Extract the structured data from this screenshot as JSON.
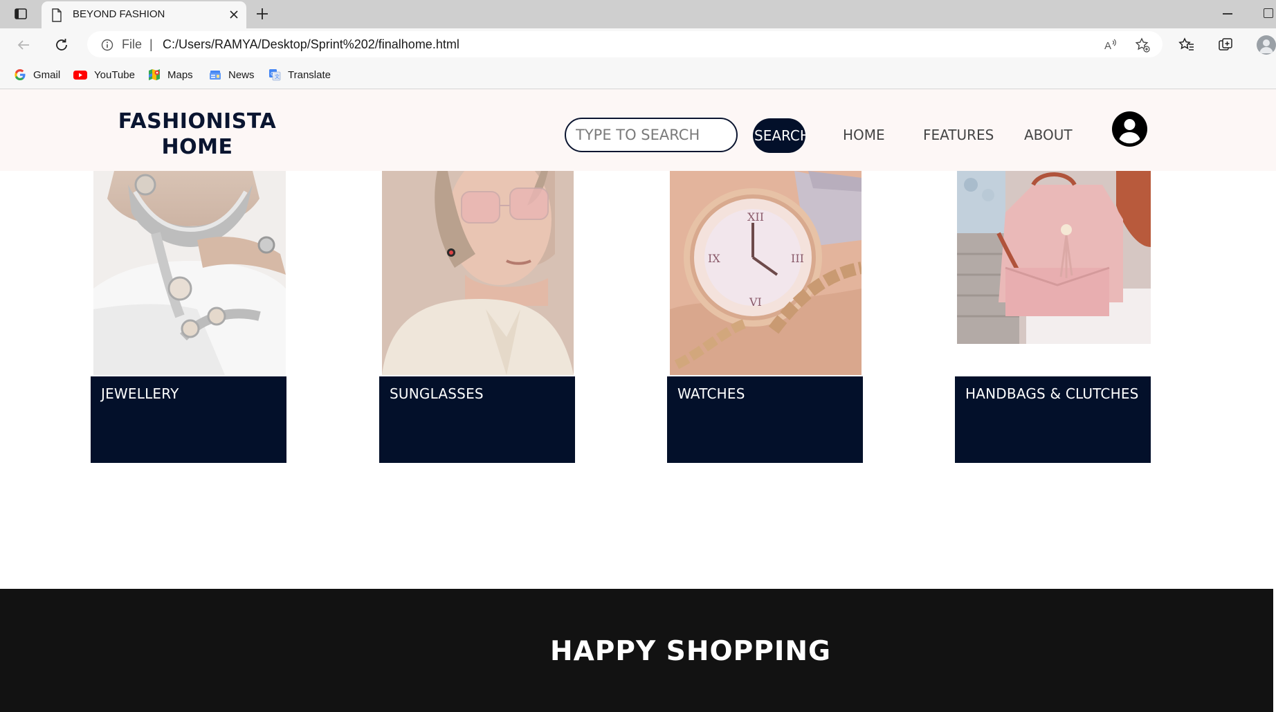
{
  "browser": {
    "tab_title": "BEYOND FASHION",
    "address": {
      "scheme_label": "File",
      "separator": "|",
      "url": "C:/Users/RAMYA/Desktop/Sprint%202/finalhome.html"
    },
    "bookmarks": [
      {
        "label": "Gmail",
        "icon": "google-icon"
      },
      {
        "label": "YouTube",
        "icon": "youtube-icon"
      },
      {
        "label": "Maps",
        "icon": "maps-icon"
      },
      {
        "label": "News",
        "icon": "news-icon"
      },
      {
        "label": "Translate",
        "icon": "translate-icon"
      }
    ]
  },
  "header": {
    "brand_line1": "FASHIONISTA",
    "brand_line2": "HOME",
    "search_placeholder": "TYPE TO SEARCH",
    "search_button": "SEARCH",
    "nav": [
      "HOME",
      "FEATURES",
      "ABOUT"
    ],
    "user_icon": "user-circle-icon"
  },
  "categories": [
    {
      "label": "JEWELLERY",
      "image": "jewellery-photo"
    },
    {
      "label": "SUNGLASSES",
      "image": "sunglasses-photo"
    },
    {
      "label": "WATCHES",
      "image": "watch-photo"
    },
    {
      "label": "HANDBAGS & CLUTCHES",
      "image": "handbag-photo"
    }
  ],
  "footer": {
    "title": "HAPPY SHOPPING"
  },
  "colors": {
    "navy": "#03102a",
    "header_bg": "#fdf7f6",
    "footer_bg": "#121212"
  }
}
